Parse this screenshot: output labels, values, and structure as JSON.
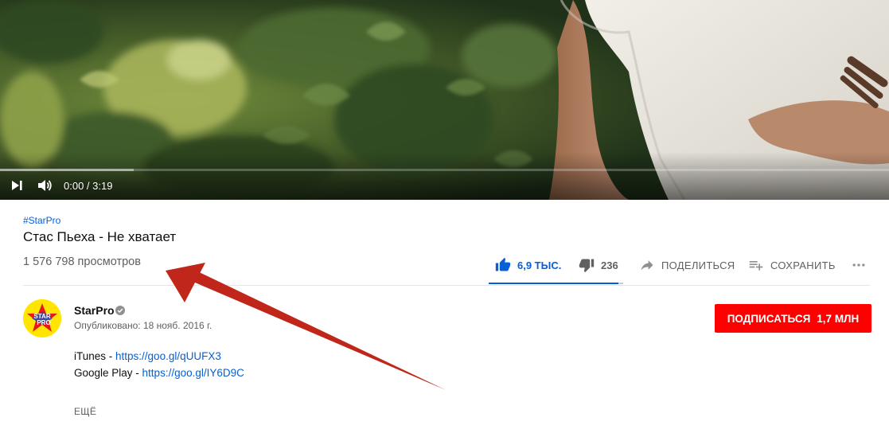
{
  "player": {
    "time_current": "0:00",
    "time_total": "3:19",
    "time_display": "0:00 / 3:19",
    "progress_played": 0,
    "progress_buffered": 0.15
  },
  "video": {
    "hashtag": "#StarPro",
    "title": "Стас Пьеха - Не хватает",
    "views": "1 576 798 просмотров"
  },
  "actions": {
    "like_count": "6,9 ТЫС.",
    "dislike_count": "236",
    "share_label": "ПОДЕЛИТЬСЯ",
    "save_label": "СОХРАНИТЬ",
    "like_ratio": 0.967
  },
  "channel": {
    "name": "StarPro",
    "published": "Опубликовано: 18 нояб. 2016 г.",
    "avatar_text_top": "STAR",
    "avatar_text_bottom": "PRO"
  },
  "subscribe": {
    "label": "ПОДПИСАТЬСЯ",
    "count": "1,7 МЛН"
  },
  "description": {
    "line1_prefix": "iTunes - ",
    "line1_link": "https://goo.gl/qUUFX3",
    "line2_prefix": "Google Play - ",
    "line2_link": "https://goo.gl/IY6D9C",
    "show_more": "ЕЩЁ"
  },
  "colors": {
    "link_blue": "#065fd4",
    "subscribe_red": "#ff0000",
    "annotation_red": "#c0271a",
    "avatar_yellow": "#ffe500"
  },
  "icons": {
    "play": "play-next-icon",
    "volume": "volume-icon",
    "like": "thumbs-up-icon",
    "dislike": "thumbs-down-icon",
    "share": "share-arrow-icon",
    "save": "playlist-add-icon",
    "more": "more-dots-icon",
    "verified": "verified-check-icon"
  }
}
